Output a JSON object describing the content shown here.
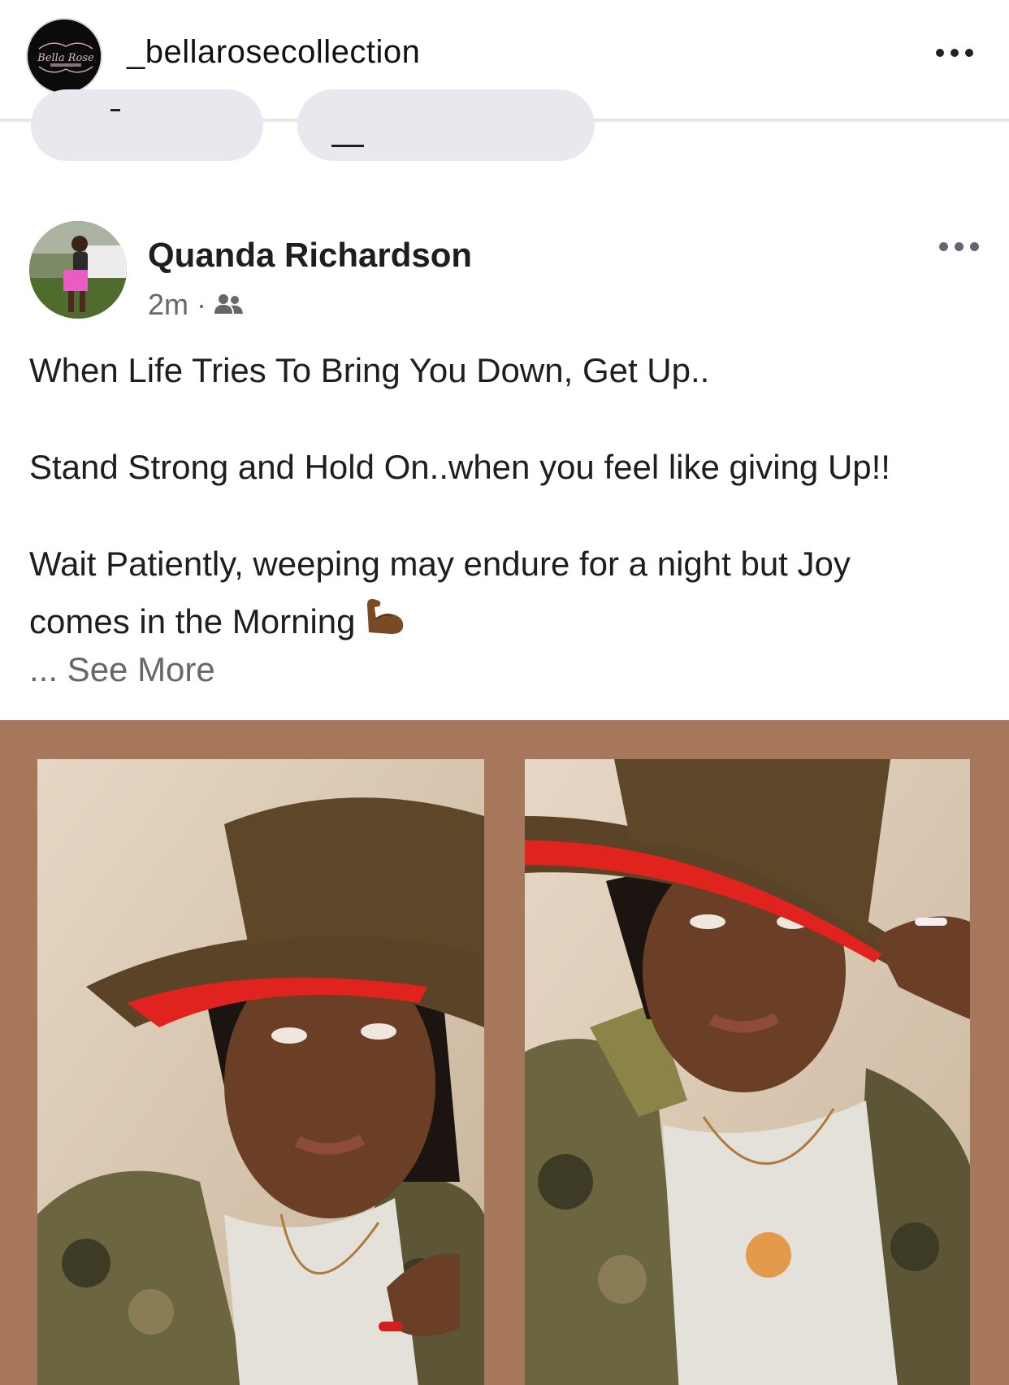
{
  "instagram": {
    "username": "_bellarosecollection",
    "avatar_logo_text": "Bella Rose Collection",
    "more_icon": "more-horizontal-icon"
  },
  "facebook_post": {
    "author": "Quanda Richardson",
    "time": "2m",
    "separator": "·",
    "audience_icon": "friends-icon",
    "more_icon": "more-horizontal-icon",
    "lines": [
      "When Life Tries To Bring You Down, Get Up..",
      "Stand Strong and Hold On..when you feel like giving Up!!",
      "Wait Patiently, weeping may endure for a night but Joy",
      "comes in the Morning"
    ],
    "emoji": "flexed-biceps-icon",
    "see_more": "... See More"
  },
  "colors": {
    "collage_background": "#a7775c",
    "hat_brown": "#5a4326",
    "hat_red_brim": "#e0231f",
    "secondary_text": "#65676b"
  }
}
